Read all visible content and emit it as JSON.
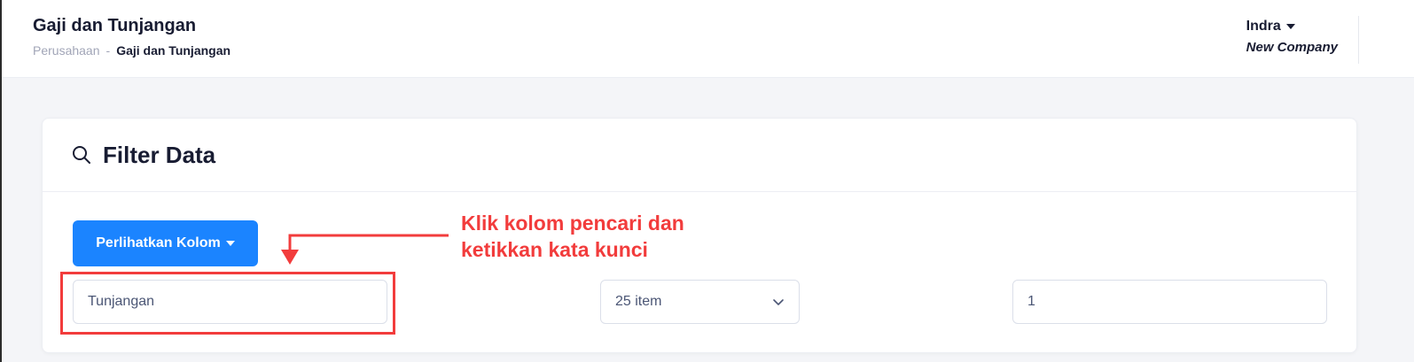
{
  "header": {
    "title": "Gaji dan Tunjangan",
    "breadcrumb": {
      "parent": "Perusahaan",
      "separator": "-",
      "current": "Gaji dan Tunjangan"
    },
    "user": {
      "name": "Indra",
      "company": "New Company"
    }
  },
  "filter_card": {
    "title": "Filter Data",
    "show_columns_label": "Perlihatkan Kolom",
    "search_value": "Tunjangan",
    "page_size_value": "25 item",
    "page_value": "1"
  },
  "annotation": {
    "line1": "Klik kolom pencari dan",
    "line2": "ketikkan kata kunci"
  },
  "colors": {
    "primary": "#1b84ff",
    "annotation": "#f23c3c"
  }
}
